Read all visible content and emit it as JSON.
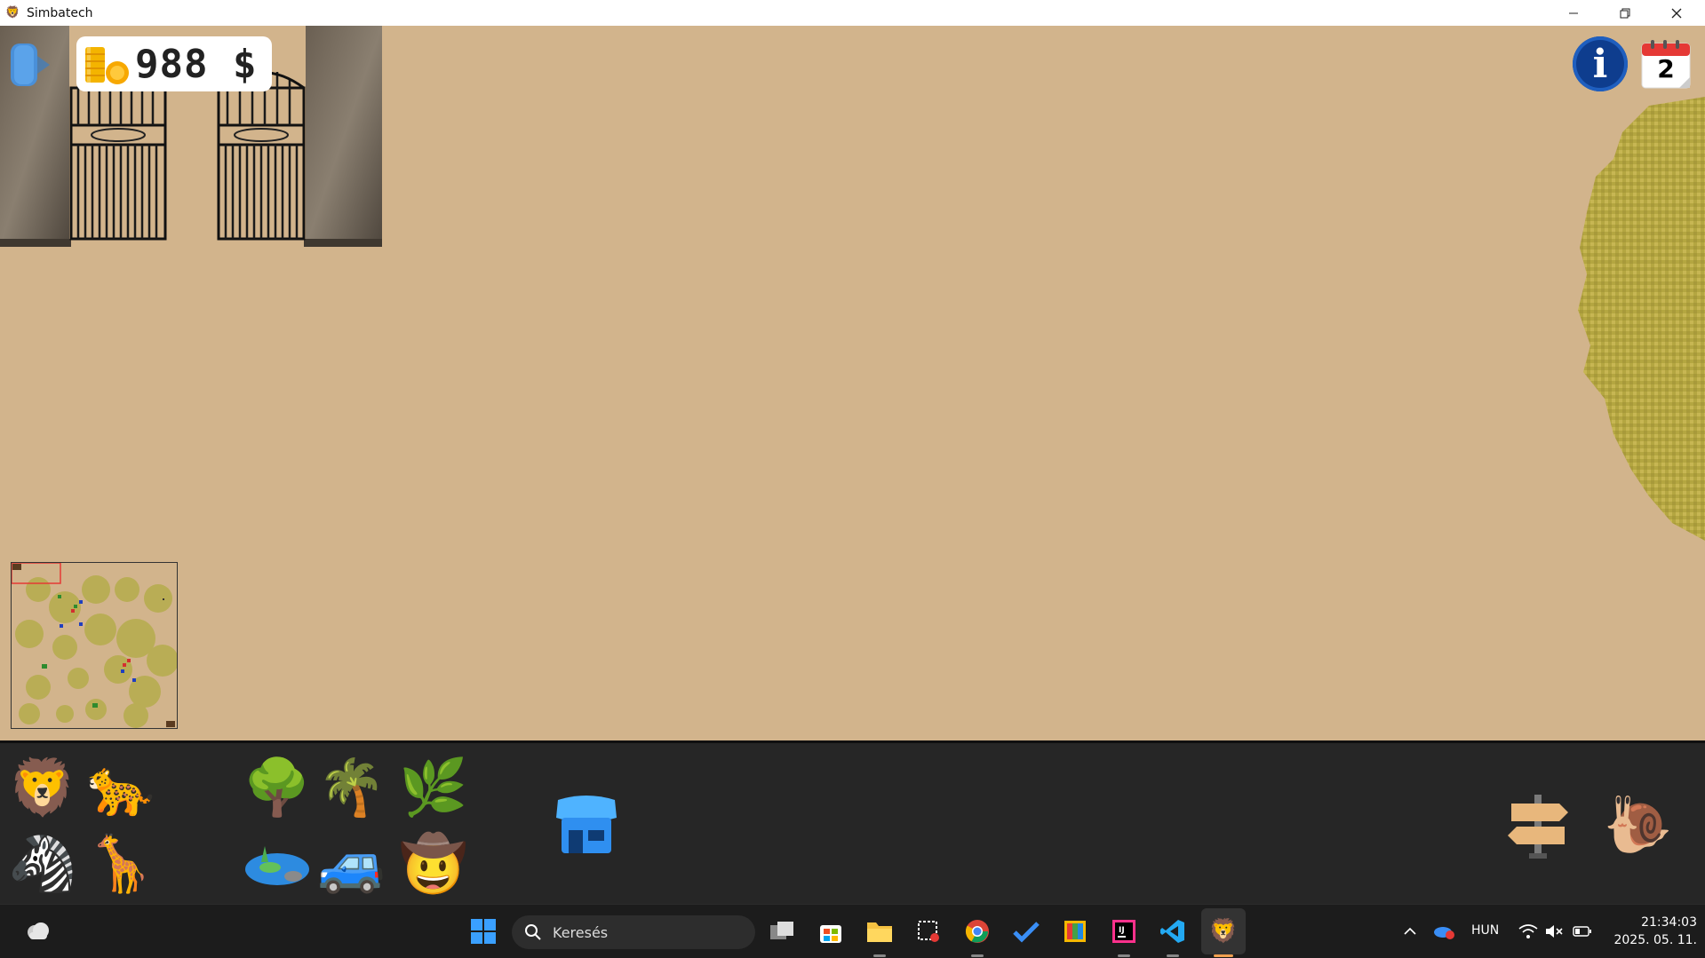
{
  "window": {
    "title": "Simbatech",
    "app_icon": "lion-icon",
    "controls": [
      "minimize-icon",
      "maximize-icon",
      "close-icon"
    ]
  },
  "hud": {
    "money": "988 $",
    "calendar_day": "2",
    "info_label": "i",
    "exit_icon": "exit-door-icon"
  },
  "toolbar": {
    "animals": [
      "lion-icon",
      "leopard-icon",
      "zebra-icon",
      "giraffe-icon"
    ],
    "plants": [
      "baobab-tree-icon",
      "palm-tree-icon",
      "grass-icon"
    ],
    "others": [
      "lake-icon",
      "jeep-icon",
      "ranger-icon"
    ],
    "shop": "shop-icon",
    "road": "signpost-icon",
    "speed": "snail-icon"
  },
  "taskbar": {
    "search_placeholder": "Keresés",
    "language": "HUN",
    "time": "21:34:03",
    "date": "2025. 05. 11."
  },
  "colors": {
    "sand": "#d2b48c",
    "bush": "#b4a641",
    "toolbar": "#262626",
    "taskbar": "#1c1c1c",
    "info_blue": "#0e3d8e"
  }
}
